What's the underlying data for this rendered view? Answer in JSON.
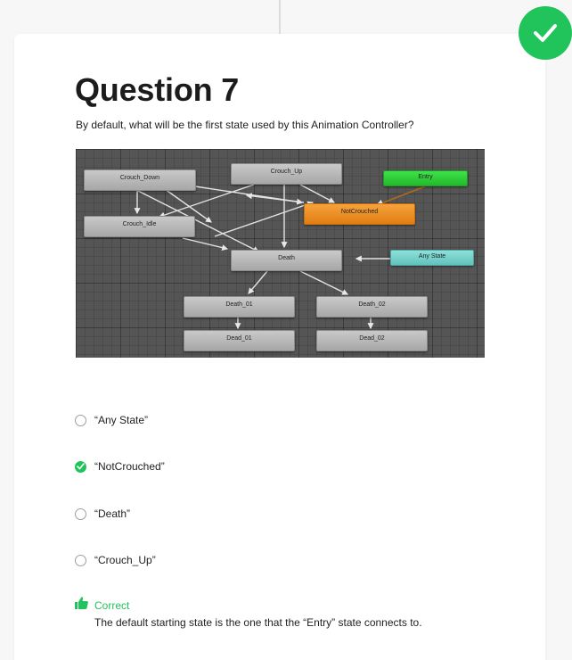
{
  "question": {
    "title": "Question 7",
    "text": "By default, what will be the first state used by this Animation Controller?"
  },
  "diagram": {
    "nodes": {
      "crouch_down": "Crouch_Down",
      "crouch_up": "Crouch_Up",
      "entry": "Entry",
      "not_crouched": "NotCrouched",
      "crouch_idle": "Crouch_Idle",
      "death": "Death",
      "any_state": "Any State",
      "death_01": "Death_01",
      "death_02": "Death_02",
      "dead_01": "Dead_01",
      "dead_02": "Dead_02"
    },
    "colors": {
      "default_state": "#e88a1f",
      "entry": "#2ec936",
      "any_state": "#74d2cb",
      "state": "#b8b8b8"
    }
  },
  "options": [
    {
      "label": "“Any State”",
      "selected": false
    },
    {
      "label": "“NotCrouched”",
      "selected": true
    },
    {
      "label": "“Death”",
      "selected": false
    },
    {
      "label": "“Crouch_Up”",
      "selected": false
    }
  ],
  "result": {
    "status": "Correct",
    "explanation": "The default starting state is the one that the “Entry” state connects to.",
    "color": "#21c45a"
  }
}
